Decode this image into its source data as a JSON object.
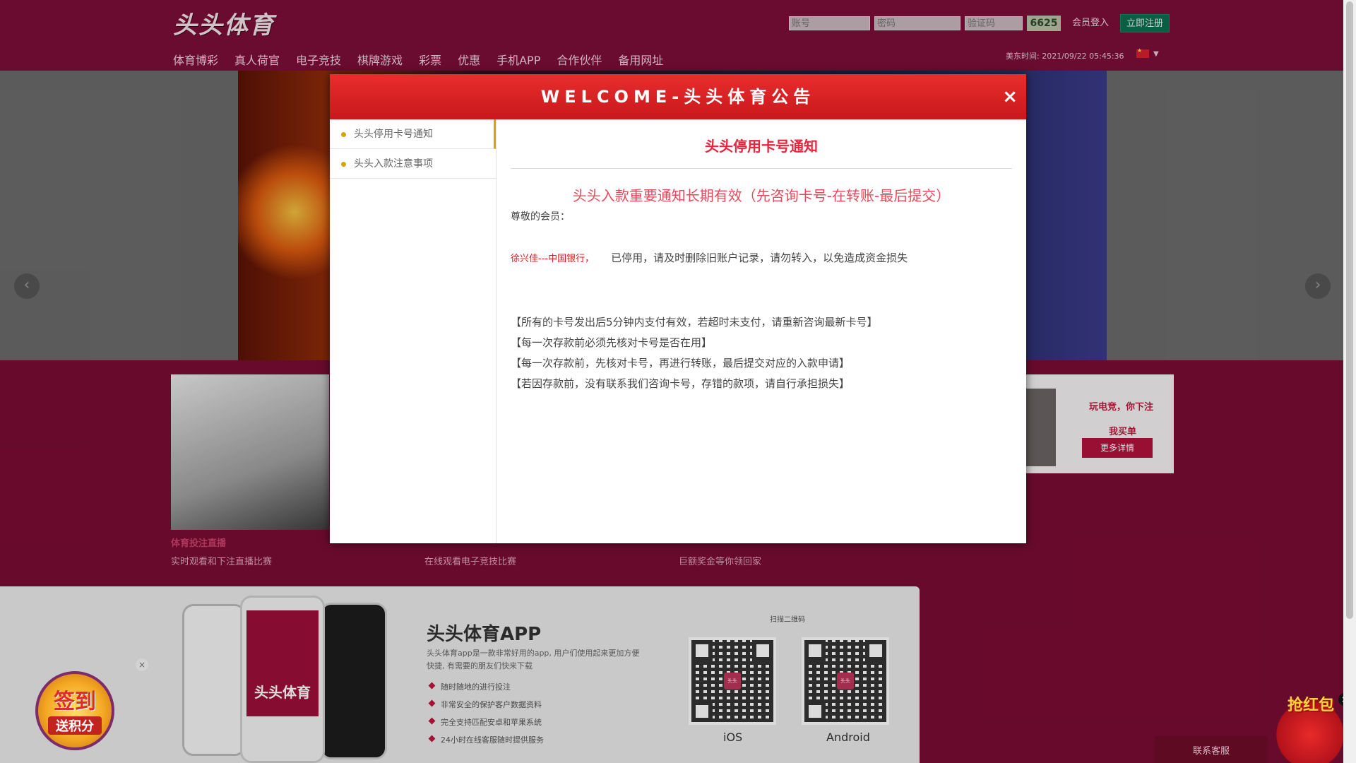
{
  "header": {
    "logo": "头头体育",
    "account_placeholder": "账号",
    "password_placeholder": "密码",
    "captcha_placeholder": "验证码",
    "captcha_code": "6625",
    "login_label": "会员登入",
    "register_label": "立即注册",
    "us_time_label": "美东时间:",
    "us_time_value": "2021/09/22 05:45:36",
    "nav": [
      "体育博彩",
      "真人荷官",
      "电子竞技",
      "棋牌游戏",
      "彩票",
      "优惠",
      "手机APP",
      "合作伙伴",
      "备用网址"
    ]
  },
  "banner": {
    "prev_icon": "‹",
    "next_icon": "›"
  },
  "promos": {
    "left_caption_title": "体育投注直播",
    "left_caption_sub": "实时观看和下注直播比赛",
    "mid_caption_sub": "在线观看电子竞技比赛",
    "right_caption_sub": "巨额奖金等你领回家",
    "esports_title": "玩电竞，你下注",
    "esports_sub": "我买单",
    "esports_button": "更多详情"
  },
  "app": {
    "title": "头头体育APP",
    "desc": "头头体育app是一款非常好用的app, 用户们使用起来更加方便快捷, 有需要的朋友们快来下载",
    "features": [
      "随时随地的进行投注",
      "非常安全的保护客户数据资料",
      "完全支持匹配安卓和苹果系统",
      "24小时在线客服随时提供服务"
    ],
    "qr_title": "扫描二维码",
    "qr_center": "头头",
    "ios_label": "iOS",
    "android_label": "Android",
    "phone_logo": "头头体育"
  },
  "widgets": {
    "sign_line1": "签到",
    "sign_line2": "送积分",
    "close_glyph": "×",
    "redpack_label": "抢红包",
    "support_label": "联系客服"
  },
  "modal": {
    "title": "WELCOME-头头体育公告",
    "close_glyph": "×",
    "tabs": [
      "头头停用卡号通知",
      "头头入款注意事项"
    ],
    "heading": "头头停用卡号通知",
    "subheading": "头头入款重要通知长期有效（先咨询卡号-在转账-最后提交）",
    "greeting": "尊敬的会员：",
    "account_name": "徐兴佳---中国银行，",
    "account_notice": "已停用，请及时删除旧账户记录，请勿转入，以免造成资金损失",
    "rules": [
      "【所有的卡号发出后5分钟内支付有效，若超时未支付，请重新咨询最新卡号】",
      "【每一次存款前必须先核对卡号是否在用】",
      "【每一次存款前，先核对卡号，再进行转账，最后提交对应的入款申请】",
      "【若因存款前，没有联系我们咨询卡号，存错的款项，请自行承担损失】"
    ]
  },
  "colors": {
    "brand_maroon": "#7c0f37",
    "modal_red": "#d42222",
    "heading_red": "#e8243c",
    "tab_dot": "#d6a500"
  }
}
